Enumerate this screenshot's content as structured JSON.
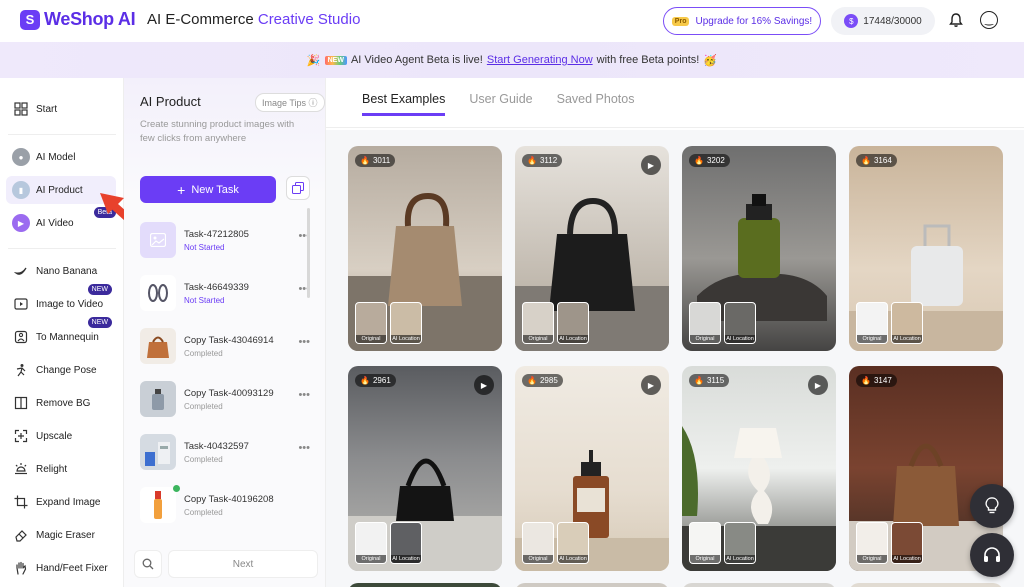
{
  "header": {
    "logo_text": "WeShop AI",
    "title_prefix": "AI E-Commerce ",
    "title_accent": "Creative Studio",
    "upgrade_label": "Upgrade for 16% Savings!",
    "pro_badge": "Pro",
    "points": "17448/30000"
  },
  "banner": {
    "new_tag": "NEW",
    "text_before": "AI Video Agent Beta is live!",
    "link_text": "Start Generating Now",
    "text_after": "with free Beta points!"
  },
  "sidebar": {
    "start": "Start",
    "ai_model": "AI Model",
    "ai_product": "AI Product",
    "ai_video": "AI Video",
    "ai_video_badge": "Beta",
    "nano_banana": "Nano Banana",
    "image_to_video": "Image to Video",
    "image_to_video_badge": "NEW",
    "to_mannequin": "To Mannequin",
    "to_mannequin_badge": "NEW",
    "change_pose": "Change Pose",
    "remove_bg": "Remove BG",
    "upscale": "Upscale",
    "relight": "Relight",
    "expand_image": "Expand Image",
    "magic_eraser": "Magic Eraser",
    "hand_feet_fixer": "Hand/Feet Fixer"
  },
  "task_panel": {
    "title": "AI Product",
    "image_tips": "Image Tips",
    "description": "Create stunning product images with few clicks from anywhere",
    "new_task": "New Task",
    "next": "Next",
    "tasks": [
      {
        "name": "Task-47212805",
        "status": "Not Started"
      },
      {
        "name": "Task-46649339",
        "status": "Not Started"
      },
      {
        "name": "Copy Task-43046914",
        "status": "Completed"
      },
      {
        "name": "Copy Task-40093129",
        "status": "Completed"
      },
      {
        "name": "Task-40432597",
        "status": "Completed"
      },
      {
        "name": "Copy Task-40196208",
        "status": "Completed"
      }
    ]
  },
  "main": {
    "tabs": [
      "Best Examples",
      "User Guide",
      "Saved Photos"
    ],
    "mini_labels": [
      "Original",
      "AI Location"
    ],
    "cards": [
      {
        "count": "3011"
      },
      {
        "count": "3112"
      },
      {
        "count": "3202"
      },
      {
        "count": "3164"
      },
      {
        "count": "2961"
      },
      {
        "count": "2985"
      },
      {
        "count": "3115"
      },
      {
        "count": "3147"
      }
    ]
  }
}
